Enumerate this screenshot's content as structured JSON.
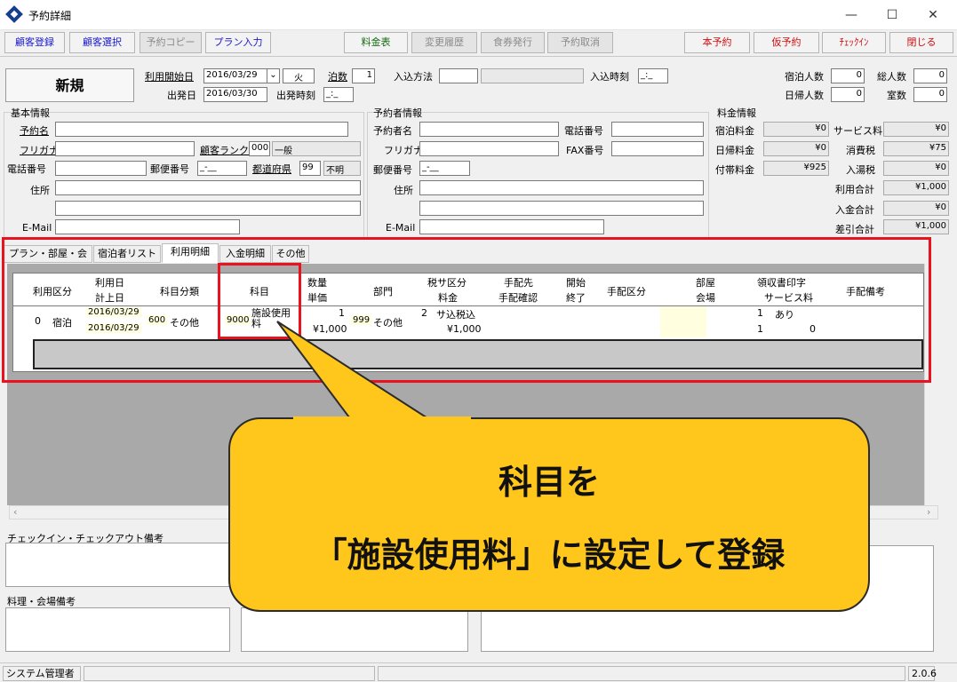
{
  "window": {
    "title": "予約詳細",
    "min": "—",
    "max": "☐",
    "close": "✕"
  },
  "toolbar": {
    "left": [
      "顧客登録",
      "顧客選択",
      "予約コピー",
      "プラン入力"
    ],
    "center": [
      "料金表",
      "変更履歴",
      "食券発行",
      "予約取消"
    ],
    "right": [
      "本予約",
      "仮予約",
      "ﾁｪｯｸｲﾝ",
      "閉じる"
    ]
  },
  "header": {
    "status": "新規",
    "start_date_label": "利用開始日",
    "start_date": "2016/03/29",
    "weekday": "火",
    "nights_label": "泊数",
    "nights": "1",
    "entry_method_label": "入込方法",
    "entry_time_label": "入込時刻",
    "entry_time": "_:_",
    "depart_date_label": "出発日",
    "depart_date": "2016/03/30",
    "depart_time_label": "出発時刻",
    "depart_time": "_:_",
    "guests_label": "宿泊人数",
    "guests": "0",
    "total_label": "総人数",
    "total": "0",
    "day_label": "日帰人数",
    "day": "0",
    "rooms_label": "室数",
    "rooms": "0"
  },
  "basic": {
    "section": "基本情報",
    "name_label": "予約名",
    "kana_label": "フリガナ",
    "rank_label": "顧客ランク",
    "rank_code": "000",
    "rank_name": "一般",
    "tel_label": "電話番号",
    "zip_label": "郵便番号",
    "zip": "_-__",
    "pref_label": "都道府県",
    "pref_code": "99",
    "pref_name": "不明",
    "addr_label": "住所",
    "email_label": "E-Mail"
  },
  "booker": {
    "section": "予約者情報",
    "name_label": "予約者名",
    "tel_label": "電話番号",
    "kana_label": "フリガナ",
    "fax_label": "FAX番号",
    "zip_label": "郵便番号",
    "zip": "_-__",
    "addr_label": "住所",
    "email_label": "E-Mail"
  },
  "fees": {
    "section": "料金情報",
    "rows": [
      {
        "l1": "宿泊料金",
        "v1": "¥0",
        "l2": "サービス料",
        "v2": "¥0"
      },
      {
        "l1": "日帰料金",
        "v1": "¥0",
        "l2": "消費税",
        "v2": "¥75"
      },
      {
        "l1": "付帯料金",
        "v1": "¥925",
        "l2": "入湯税",
        "v2": "¥0"
      }
    ],
    "usage_total_label": "利用合計",
    "usage_total": "¥1,000",
    "paid_label": "入金合計",
    "paid": "¥0",
    "balance_label": "差引合計",
    "balance": "¥1,000"
  },
  "tabs": [
    "プラン・部屋・会場",
    "宿泊者リスト",
    "利用明細",
    "入金明細",
    "その他"
  ],
  "grid": {
    "headers": {
      "kubun": "利用区分",
      "date1": "利用日",
      "date2": "計上日",
      "bunrui": "科目分類",
      "kamoku": "科目",
      "qty": "数量",
      "price": "単価",
      "dept": "部門",
      "tax": "税サ区分",
      "fee": "料金",
      "dest": "手配先",
      "confirm": "手配確認",
      "start": "開始",
      "end": "終了",
      "arrange": "手配区分",
      "room": "部屋",
      "venue": "会場",
      "receipt": "領収書印字",
      "service": "サービス料",
      "note": "手配備考"
    },
    "row": {
      "num": "0",
      "kubun": "宿泊",
      "date1": "2016/03/29",
      "date2": "2016/03/29",
      "bunrui_code": "600",
      "bunrui": "その他",
      "kamoku_code": "9000",
      "kamoku": "施設使用料",
      "qty": "1",
      "price": "¥1,000",
      "dept_code": "999",
      "dept": "その他",
      "tax_code": "2",
      "tax": "サ込税込",
      "fee": "¥1,000",
      "receipt_code": "1",
      "receipt": "あり",
      "service_code": "1",
      "service": "0"
    }
  },
  "memos": {
    "checkin": "チェックイン・チェックアウト備考",
    "cooking": "料理・会場備考"
  },
  "callout": {
    "line1": "科目を",
    "line2": "「施設使用料」に設定して登録"
  },
  "status": {
    "user": "システム管理者",
    "version": "2.0.6"
  }
}
